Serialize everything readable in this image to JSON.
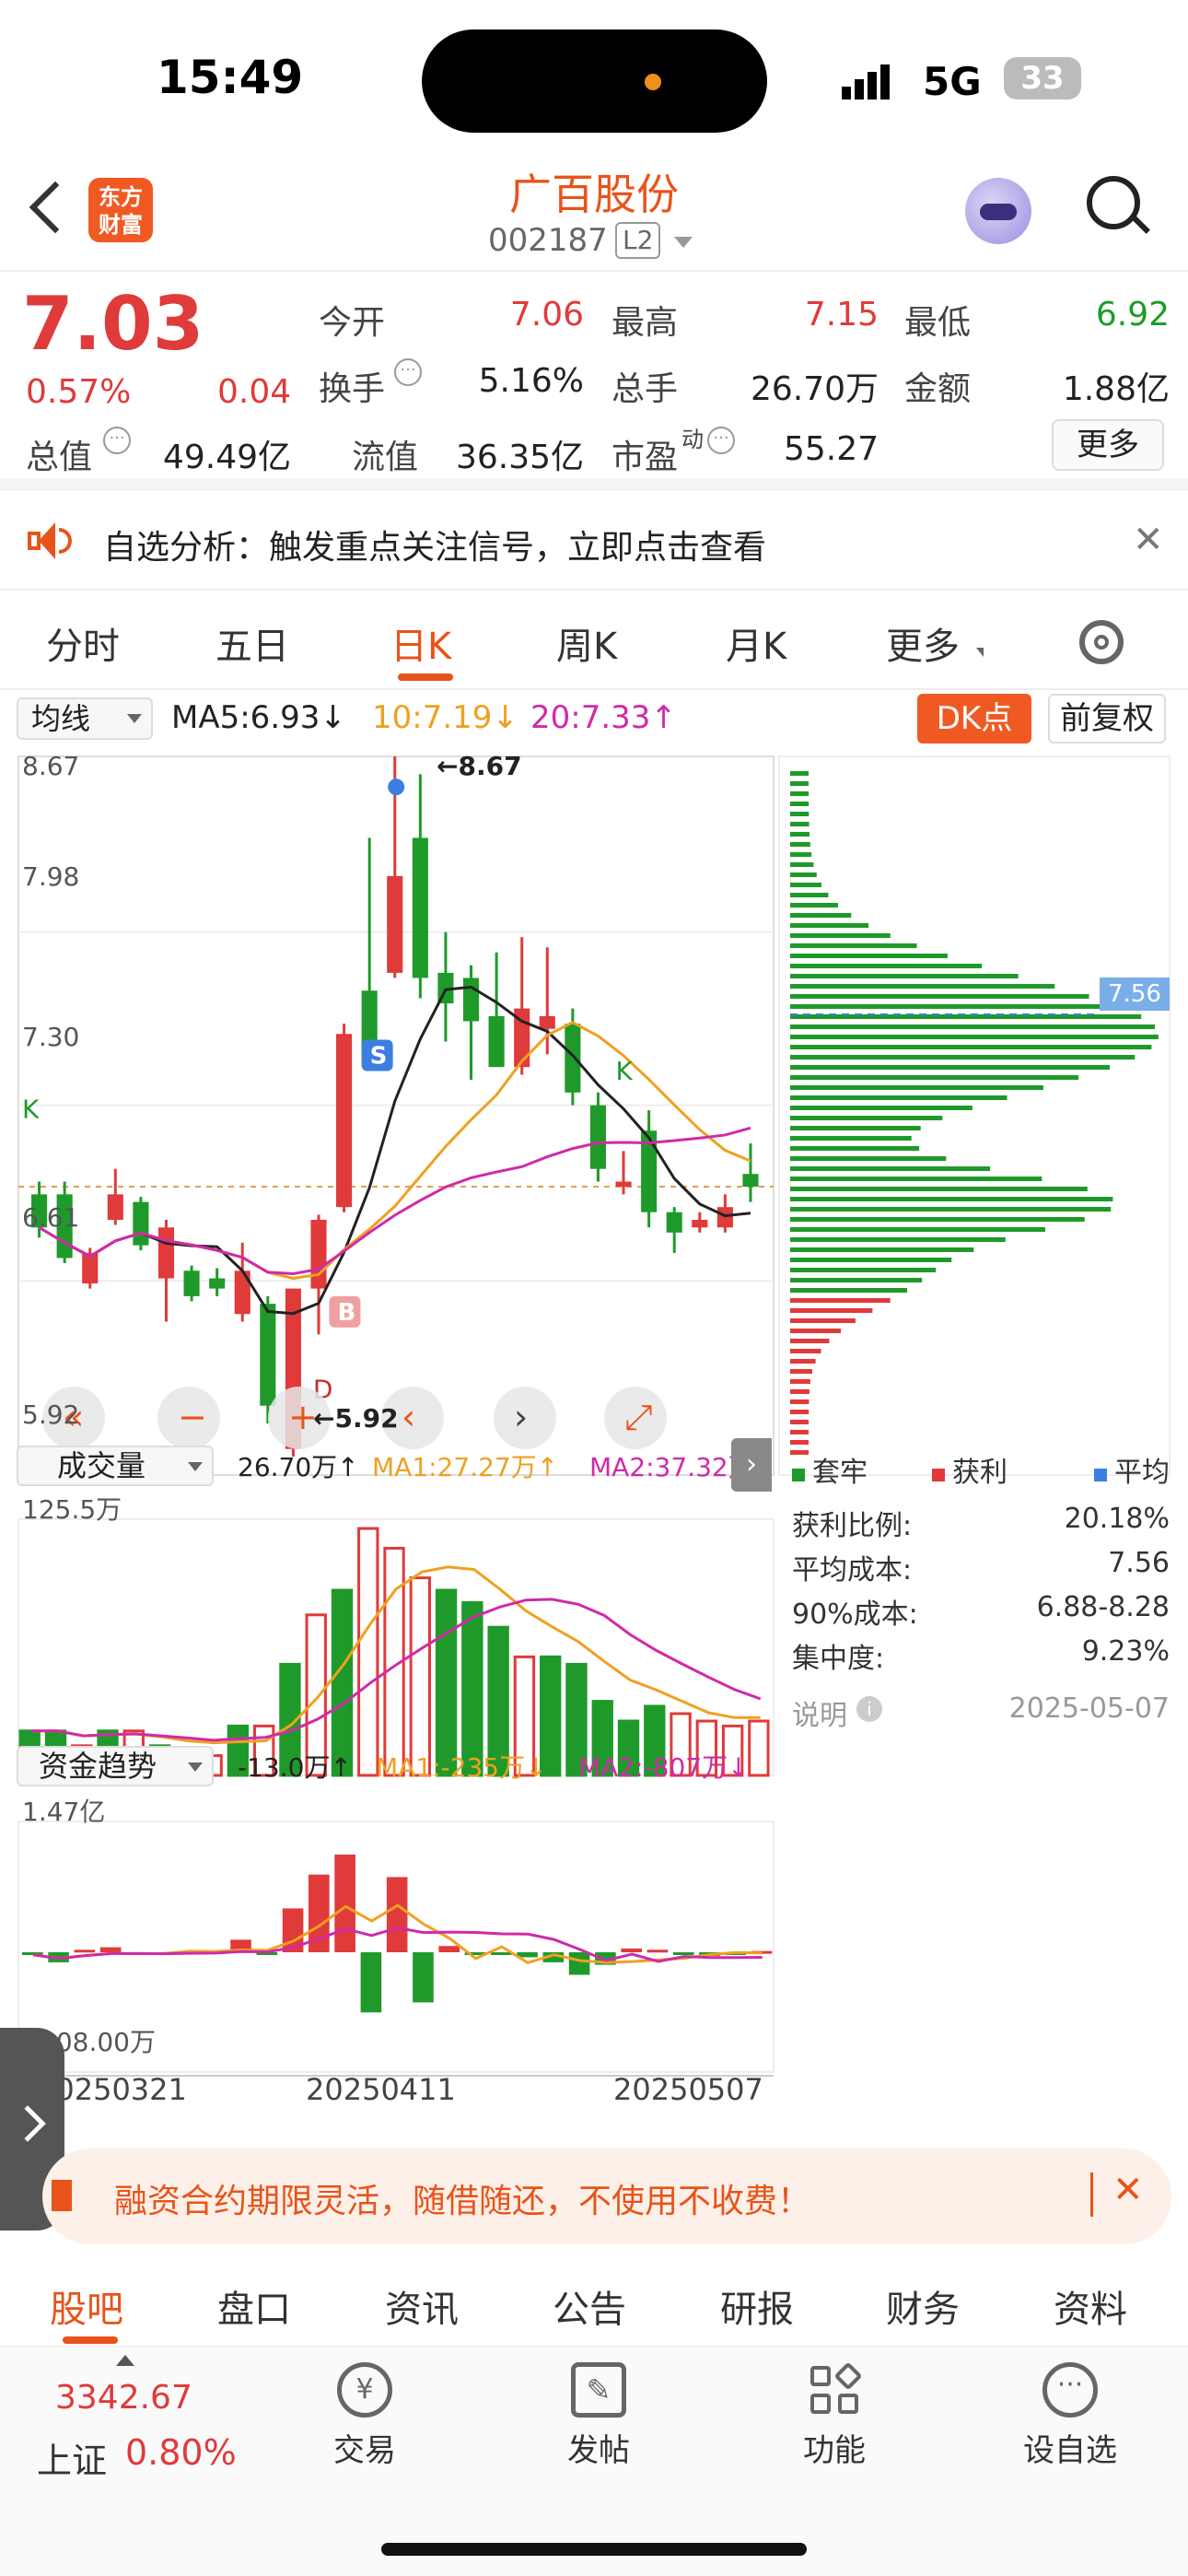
{
  "status_bar": {
    "time": "15:49",
    "network": "5G",
    "battery": "33"
  },
  "header": {
    "logo_text": "东方\n财富",
    "stock_name": "广百股份",
    "stock_code": "002187",
    "level": "L2"
  },
  "quote": {
    "price": "7.03",
    "change_pct": "0.57%",
    "change_amt": "0.04",
    "open_label": "今开",
    "open": "7.06",
    "high_label": "最高",
    "high": "7.15",
    "low_label": "最低",
    "low": "6.92",
    "turnover_label": "换手",
    "turnover": "5.16%",
    "volume_label": "总手",
    "volume": "26.70万",
    "amount_label": "金额",
    "amount": "1.88亿",
    "mktcap_label": "总值",
    "mktcap": "49.49亿",
    "float_label": "流值",
    "float_cap": "36.35亿",
    "pe_label": "市盈",
    "pe_sup": "动",
    "pe": "55.27",
    "more_button": "更多"
  },
  "notice": {
    "text": "自选分析：触发重点关注信号，立即点击查看"
  },
  "tabs": [
    "分时",
    "五日",
    "日K",
    "周K",
    "月K",
    "更多"
  ],
  "active_tab": "日K",
  "chart_header": {
    "indicator_select": "均线",
    "ma5": "MA5:6.93↓",
    "ma10": "10:7.19↓",
    "ma20": "20:7.33↑",
    "dk_button": "DK点",
    "adjust_button": "前复权"
  },
  "price_axis": [
    "8.67",
    "7.98",
    "7.30",
    "6.61",
    "5.92"
  ],
  "annotations": {
    "high": "8.67",
    "low": "5.92",
    "cost_line": "7.56"
  },
  "volume_panel": {
    "select": "成交量",
    "value": "26.70万↑",
    "ma1": "MA1:27.27万↑",
    "ma2": "MA2:37.32万↓",
    "axis_top": "125.5万"
  },
  "fund_panel": {
    "select": "资金趋势",
    "value": "-13.0万↑",
    "ma1": "MA1:-235万↓",
    "ma2": "MA2:-807万↓",
    "axis_top": "1.47亿",
    "axis_bottom": "-1.08.00万"
  },
  "date_axis": [
    "20250321",
    "20250411",
    "20250507"
  ],
  "chip_legend": [
    "套牢",
    "获利",
    "平均"
  ],
  "chip_stats": {
    "profit_ratio_label": "获利比例:",
    "profit_ratio": "20.18%",
    "avg_cost_label": "平均成本:",
    "avg_cost": "7.56",
    "cost90_label": "90%成本:",
    "cost90": "6.88-8.28",
    "concentration_label": "集中度:",
    "concentration": "9.23%",
    "note_label": "说明",
    "date": "2025-05-07"
  },
  "promo": {
    "text": "融资合约期限灵活，随借随还，不使用不收费！"
  },
  "sub_tabs": [
    "股吧",
    "盘口",
    "资讯",
    "公告",
    "研报",
    "财务",
    "资料"
  ],
  "active_sub_tab": "股吧",
  "bottom_bar": {
    "index_value": "3342.67",
    "index_name": "上证",
    "index_change": "0.80%",
    "trade": "交易",
    "post": "发帖",
    "features": "功能",
    "add_watch": "设自选"
  },
  "chart_data": {
    "type": "candlestick",
    "ylim": [
      5.92,
      8.67
    ],
    "candles": [
      {
        "o": 6.95,
        "c": 6.82,
        "h": 7.0,
        "l": 6.78,
        "dir": "down"
      },
      {
        "o": 6.95,
        "c": 6.7,
        "h": 7.0,
        "l": 6.68,
        "dir": "down"
      },
      {
        "o": 6.72,
        "c": 6.6,
        "h": 6.74,
        "l": 6.58,
        "dir": "up"
      },
      {
        "o": 6.85,
        "c": 6.95,
        "h": 7.05,
        "l": 6.83,
        "dir": "up"
      },
      {
        "o": 6.75,
        "c": 6.92,
        "h": 6.94,
        "l": 6.73,
        "dir": "down"
      },
      {
        "o": 6.82,
        "c": 6.62,
        "h": 6.85,
        "l": 6.45,
        "dir": "up"
      },
      {
        "o": 6.55,
        "c": 6.65,
        "h": 6.67,
        "l": 6.53,
        "dir": "down"
      },
      {
        "o": 6.62,
        "c": 6.58,
        "h": 6.66,
        "l": 6.55,
        "dir": "down"
      },
      {
        "o": 6.65,
        "c": 6.48,
        "h": 6.76,
        "l": 6.45,
        "dir": "up"
      },
      {
        "o": 6.52,
        "c": 6.12,
        "h": 6.55,
        "l": 6.05,
        "dir": "down"
      },
      {
        "o": 5.95,
        "c": 6.58,
        "h": 6.58,
        "l": 5.92,
        "dir": "up"
      },
      {
        "o": 6.58,
        "c": 6.85,
        "h": 6.87,
        "l": 6.4,
        "dir": "up"
      },
      {
        "o": 6.9,
        "c": 7.58,
        "h": 7.62,
        "l": 6.88,
        "dir": "up"
      },
      {
        "o": 7.48,
        "c": 7.75,
        "h": 8.35,
        "l": 7.45,
        "dir": "down"
      },
      {
        "o": 8.2,
        "c": 7.82,
        "h": 8.67,
        "l": 7.8,
        "dir": "up"
      },
      {
        "o": 8.35,
        "c": 7.8,
        "h": 8.6,
        "l": 7.72,
        "dir": "down"
      },
      {
        "o": 7.7,
        "c": 7.82,
        "h": 7.98,
        "l": 7.55,
        "dir": "down"
      },
      {
        "o": 7.8,
        "c": 7.63,
        "h": 7.85,
        "l": 7.4,
        "dir": "down"
      },
      {
        "o": 7.65,
        "c": 7.45,
        "h": 7.9,
        "l": 7.45,
        "dir": "down"
      },
      {
        "o": 7.68,
        "c": 7.45,
        "h": 7.96,
        "l": 7.42,
        "dir": "up"
      },
      {
        "o": 7.65,
        "c": 7.6,
        "h": 7.92,
        "l": 7.5,
        "dir": "up"
      },
      {
        "o": 7.62,
        "c": 7.35,
        "h": 7.68,
        "l": 7.3,
        "dir": "down"
      },
      {
        "o": 7.3,
        "c": 7.05,
        "h": 7.35,
        "l": 7.0,
        "dir": "down"
      },
      {
        "o": 7.0,
        "c": 6.98,
        "h": 7.12,
        "l": 6.95,
        "dir": "up"
      },
      {
        "o": 7.2,
        "c": 6.88,
        "h": 7.28,
        "l": 6.82,
        "dir": "down"
      },
      {
        "o": 6.88,
        "c": 6.8,
        "h": 6.9,
        "l": 6.72,
        "dir": "down"
      },
      {
        "o": 6.82,
        "c": 6.85,
        "h": 6.88,
        "l": 6.8,
        "dir": "up"
      },
      {
        "o": 6.9,
        "c": 6.82,
        "h": 6.95,
        "l": 6.8,
        "dir": "up"
      },
      {
        "o": 6.98,
        "c": 7.03,
        "h": 7.15,
        "l": 6.92,
        "dir": "down"
      }
    ],
    "volume": [
      0.18,
      0.18,
      0.12,
      0.18,
      0.18,
      0.12,
      0.1,
      0.08,
      0.2,
      0.2,
      0.45,
      0.65,
      0.75,
      1.0,
      0.92,
      0.8,
      0.75,
      0.7,
      0.6,
      0.48,
      0.48,
      0.45,
      0.3,
      0.22,
      0.28,
      0.25,
      0.22,
      0.2,
      0.22
    ],
    "volume_up": [
      false,
      false,
      true,
      false,
      true,
      false,
      false,
      true,
      false,
      true,
      false,
      true,
      false,
      true,
      true,
      true,
      false,
      false,
      false,
      true,
      false,
      false,
      false,
      false,
      false,
      true,
      true,
      true,
      true
    ],
    "fund": [
      -0.02,
      -0.08,
      0.02,
      0.04,
      -0.01,
      -0.02,
      0.01,
      0.01,
      0.1,
      -0.02,
      0.35,
      0.62,
      0.78,
      -0.48,
      0.6,
      -0.4,
      0.05,
      -0.02,
      -0.01,
      -0.04,
      -0.08,
      -0.18,
      -0.1,
      0.03,
      0.02,
      -0.01,
      -0.03,
      -0.02,
      0.01
    ]
  }
}
